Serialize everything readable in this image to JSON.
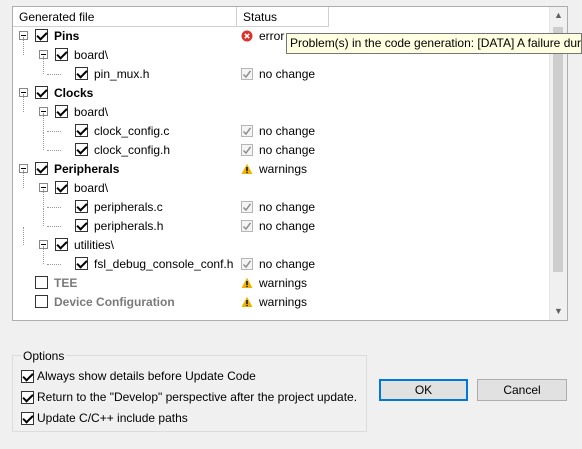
{
  "tree": {
    "columns": [
      "Generated file",
      "Status"
    ],
    "rows": [
      {
        "label": "Pins",
        "level": 0,
        "bold": true,
        "gray": false,
        "expander": true,
        "checked": true,
        "status": "error",
        "status_icon": "error-icon"
      },
      {
        "label": "board\\",
        "level": 1,
        "bold": false,
        "gray": false,
        "expander": true,
        "checked": true,
        "status": "",
        "status_icon": ""
      },
      {
        "label": "pin_mux.h",
        "level": 2,
        "bold": false,
        "gray": false,
        "expander": false,
        "checked": true,
        "status": "no change",
        "status_icon": "check-icon"
      },
      {
        "label": "Clocks",
        "level": 0,
        "bold": true,
        "gray": false,
        "expander": true,
        "checked": true,
        "status": "",
        "status_icon": ""
      },
      {
        "label": "board\\",
        "level": 1,
        "bold": false,
        "gray": false,
        "expander": true,
        "checked": true,
        "status": "",
        "status_icon": ""
      },
      {
        "label": "clock_config.c",
        "level": 2,
        "bold": false,
        "gray": false,
        "expander": false,
        "checked": true,
        "status": "no change",
        "status_icon": "check-icon"
      },
      {
        "label": "clock_config.h",
        "level": 2,
        "bold": false,
        "gray": false,
        "expander": false,
        "checked": true,
        "status": "no change",
        "status_icon": "check-icon"
      },
      {
        "label": "Peripherals",
        "level": 0,
        "bold": true,
        "gray": false,
        "expander": true,
        "checked": true,
        "status": "warnings",
        "status_icon": "warning-icon"
      },
      {
        "label": "board\\",
        "level": 1,
        "bold": false,
        "gray": false,
        "expander": true,
        "checked": true,
        "status": "",
        "status_icon": ""
      },
      {
        "label": "peripherals.c",
        "level": 2,
        "bold": false,
        "gray": false,
        "expander": false,
        "checked": true,
        "status": "no change",
        "status_icon": "check-icon"
      },
      {
        "label": "peripherals.h",
        "level": 2,
        "bold": false,
        "gray": false,
        "expander": false,
        "checked": true,
        "status": "no change",
        "status_icon": "check-icon"
      },
      {
        "label": "utilities\\",
        "level": 1,
        "bold": false,
        "gray": false,
        "expander": true,
        "checked": true,
        "status": "",
        "status_icon": ""
      },
      {
        "label": "fsl_debug_console_conf.h",
        "level": 2,
        "bold": false,
        "gray": false,
        "expander": false,
        "checked": true,
        "status": "no change",
        "status_icon": "check-icon"
      },
      {
        "label": "TEE",
        "level": 0,
        "bold": true,
        "gray": true,
        "expander": false,
        "checked": false,
        "status": "warnings",
        "status_icon": "warning-icon"
      },
      {
        "label": "Device Configuration",
        "level": 0,
        "bold": true,
        "gray": true,
        "expander": false,
        "checked": false,
        "status": "warnings",
        "status_icon": "warning-icon"
      }
    ]
  },
  "tooltip": "Problem(s) in the code generation: [DATA] A failure during",
  "options": {
    "title": "Options",
    "items": [
      {
        "label": "Always show details before Update Code",
        "checked": true
      },
      {
        "label": "Return to the \"Develop\" perspective after the project update.",
        "checked": true
      },
      {
        "label": "Update C/C++ include paths",
        "checked": true
      }
    ]
  },
  "buttons": {
    "ok": "OK",
    "cancel": "Cancel"
  },
  "colors": {
    "error": "#d9342b",
    "warning": "#f0b400",
    "check": "#8a8a8a",
    "focus": "#0078d7"
  }
}
